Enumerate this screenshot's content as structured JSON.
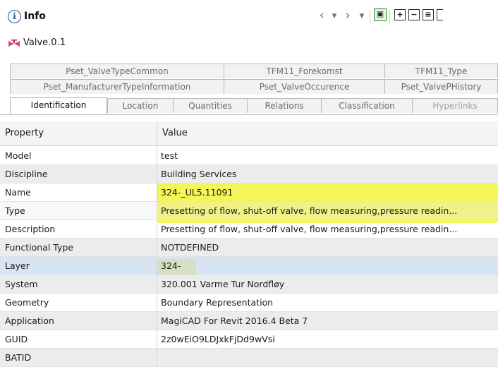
{
  "panel": {
    "title": "Info",
    "object_name": "Valve.0.1"
  },
  "toolbar": {
    "icons": [
      "back-arrow-icon",
      "chevron-down-icon",
      "forward-arrow-icon",
      "chevron-down-icon",
      "active-view-icon",
      "expand-all-icon",
      "collapse-all-icon",
      "list-icon"
    ]
  },
  "tabs": {
    "row1": [
      "Pset_ValveTypeCommon",
      "TFM11_Forekomst",
      "TFM11_Type"
    ],
    "row2": [
      "Pset_ManufacturerTypeInformation",
      "Pset_ValveOccurence",
      "Pset_ValvePHistory"
    ],
    "row3": [
      "Identification",
      "Location",
      "Quantities",
      "Relations",
      "Classification",
      "Hyperlinks"
    ],
    "selected": "Identification"
  },
  "table": {
    "columns": [
      "Property",
      "Value"
    ],
    "rows": [
      {
        "property": "Model",
        "value": "test"
      },
      {
        "property": "Discipline",
        "value": "Building Services"
      },
      {
        "property": "Name",
        "value": "324-_UL5.11091"
      },
      {
        "property": "Type",
        "value": "Presetting of flow, shut-off valve, flow measuring,pressure readin..."
      },
      {
        "property": "Description",
        "value": "Presetting of flow, shut-off valve, flow measuring,pressure readin..."
      },
      {
        "property": "Functional Type",
        "value": "NOTDEFINED"
      },
      {
        "property": "Layer",
        "value": "324-"
      },
      {
        "property": "System",
        "value": "320.001 Varme Tur Nordfløy"
      },
      {
        "property": "Geometry",
        "value": "Boundary Representation"
      },
      {
        "property": "Application",
        "value": "MagiCAD For Revit 2016.4 Beta 7"
      },
      {
        "property": "GUID",
        "value": "2z0wEiO9LDJxkFjDd9wVsi"
      },
      {
        "property": "BATID",
        "value": ""
      }
    ]
  },
  "colors": {
    "highlight": "#f2f33a",
    "selected_row": "#c6d9f0"
  }
}
